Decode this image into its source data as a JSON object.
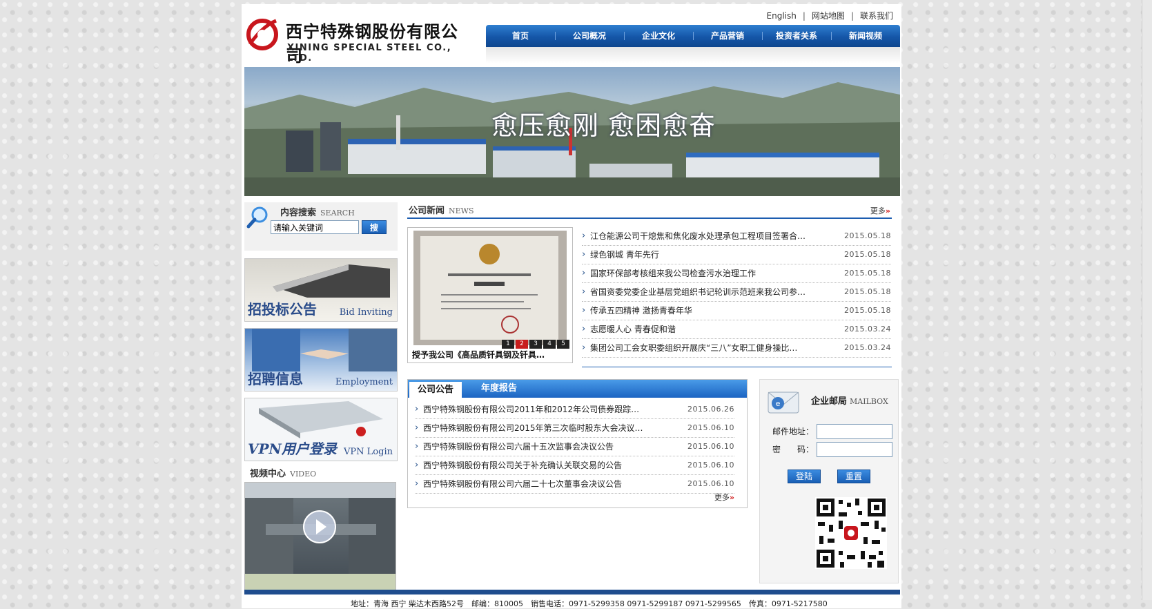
{
  "header": {
    "logo_cn": "西宁特殊钢股份有限公司",
    "logo_en": "XINING SPECIAL STEEL CO., LTD.",
    "top_links": [
      "English",
      "网站地图",
      "联系我们"
    ]
  },
  "nav": {
    "items": [
      "首页",
      "公司概况",
      "企业文化",
      "产品营销",
      "投资者关系",
      "新闻视频"
    ]
  },
  "banner": {
    "slogan": "愈压愈刚 愈困愈奋"
  },
  "search": {
    "title": "内容搜索",
    "title_en": "SEARCH",
    "placeholder": "请输入关键词",
    "button": "搜"
  },
  "promos": [
    {
      "cn": "招投标公告",
      "en": "Bid Inviting"
    },
    {
      "cn": "招聘信息",
      "en": "Employment"
    },
    {
      "cn": "VPN用户登录",
      "en": "VPN Login"
    }
  ],
  "video": {
    "title": "视频中心",
    "title_en": "VIDEO"
  },
  "news": {
    "title": "公司新闻",
    "title_en": "NEWS",
    "more": "更多",
    "photo_caption": "授予我公司《高品质钎具钢及钎具…",
    "pager": [
      "1",
      "2",
      "3",
      "4",
      "5"
    ],
    "pager_active": "2",
    "items": [
      {
        "title": "江仓能源公司干熄焦和焦化废水处理承包工程项目签署合…",
        "date": "2015.05.18"
      },
      {
        "title": "绿色钢城 青年先行",
        "date": "2015.05.18"
      },
      {
        "title": "国家环保部考核组来我公司检查污水治理工作",
        "date": "2015.05.18"
      },
      {
        "title": "省国资委党委企业基层党组织书记轮训示范班来我公司参…",
        "date": "2015.05.18"
      },
      {
        "title": "传承五四精神 激扬青春年华",
        "date": "2015.05.18"
      },
      {
        "title": "志愿暖人心 青春促和谐",
        "date": "2015.03.24"
      },
      {
        "title": "集团公司工会女职委组织开展庆“三八”女职工健身操比…",
        "date": "2015.03.24"
      }
    ]
  },
  "notices": {
    "tabs": [
      "公司公告",
      "年度报告"
    ],
    "more": "更多",
    "items": [
      {
        "title": "西宁特殊钢股份有限公司2011年和2012年公司债券跟踪评…",
        "date": "2015.06.26"
      },
      {
        "title": "西宁特殊钢股份有限公司2015年第三次临时股东大会决议…",
        "date": "2015.06.10"
      },
      {
        "title": "西宁特殊钢股份有限公司六届十五次监事会决议公告",
        "date": "2015.06.10"
      },
      {
        "title": "西宁特殊钢股份有限公司关于补充确认关联交易的公告",
        "date": "2015.06.10"
      },
      {
        "title": "西宁特殊钢股份有限公司六届二十七次董事会决议公告",
        "date": "2015.06.10"
      }
    ]
  },
  "mailbox": {
    "title": "企业邮局",
    "title_en": "MAILBOX",
    "address_label": "邮件地址：",
    "password_label": "密　　码：",
    "login": "登陆",
    "reset": "重置"
  },
  "footer": {
    "text": "地址：青海 西宁 柴达木西路52号　邮编：810005　销售电话：0971-5299358 0971-5299187 0971-5299565　传真：0971-5217580"
  },
  "colors": {
    "brand_blue": "#1556a8",
    "accent_red": "#c81d1d"
  },
  "icons": {
    "search": "magnifier-icon",
    "mail": "mail-icon",
    "play": "play-icon"
  }
}
